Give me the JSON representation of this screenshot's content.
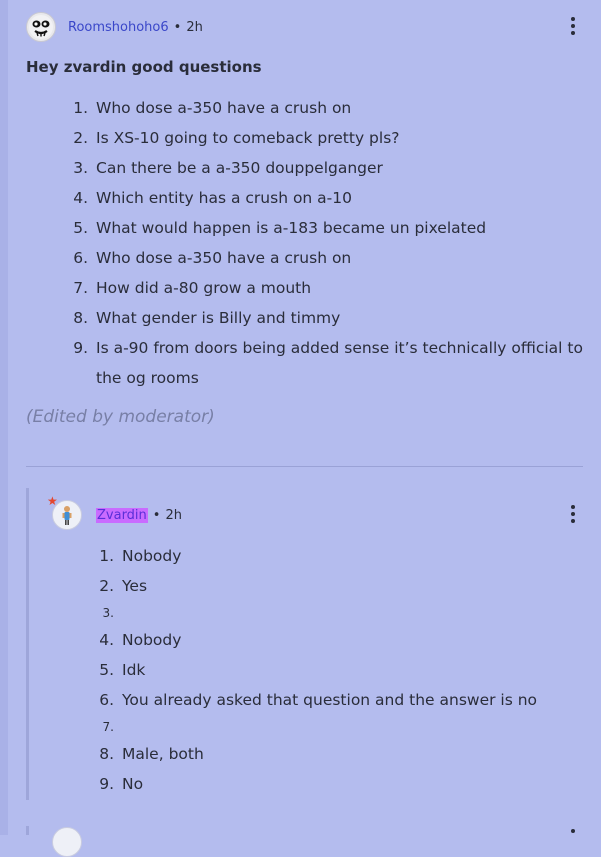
{
  "post": {
    "author": "Roomshohoho6",
    "separator": "•",
    "time": "2h",
    "title": "Hey zvardin good questions",
    "questions": [
      {
        "num": "1.",
        "text": "Who dose a-350 have a crush on"
      },
      {
        "num": "2.",
        "text": "Is XS-10 going to comeback pretty pls?"
      },
      {
        "num": "3.",
        "text": "Can there be a a-350 douppelganger"
      },
      {
        "num": "4.",
        "text": "Which entity has a crush on a-10"
      },
      {
        "num": "5.",
        "text": "What would happen is a-183 became un pixelated"
      },
      {
        "num": "6.",
        "text": "Who dose a-350 have a crush on"
      },
      {
        "num": "7.",
        "text": "How did a-80 grow a mouth"
      },
      {
        "num": "8.",
        "text": "What gender is Billy and timmy"
      },
      {
        "num": "9.",
        "text": "Is a-90 from doors being added sense it’s technically official to the og rooms"
      }
    ],
    "edited_note": "(Edited by moderator)"
  },
  "reply": {
    "author": "Zvardin",
    "separator": "•",
    "time": "2h",
    "answers": [
      {
        "num": "1.",
        "text": "Nobody"
      },
      {
        "num": "2.",
        "text": "Yes"
      },
      {
        "num": "3.",
        "text": ""
      },
      {
        "num": "4.",
        "text": "Nobody"
      },
      {
        "num": "5.",
        "text": "Idk"
      },
      {
        "num": "6.",
        "text": "You already asked that question and the answer is no"
      },
      {
        "num": "7.",
        "text": ""
      },
      {
        "num": "8.",
        "text": "Male, both"
      },
      {
        "num": "9.",
        "text": "No"
      }
    ]
  },
  "icons": {
    "post_avatar": "avatar-face-icon",
    "reply_avatar": "avatar-character-icon",
    "badge": "star-badge-icon",
    "menu": "kebab-menu-icon"
  },
  "colors": {
    "background": "#b4bcee",
    "author_link": "#3a47c9",
    "reply_highlight": "#c96bff",
    "muted_text": "#787fa6"
  }
}
